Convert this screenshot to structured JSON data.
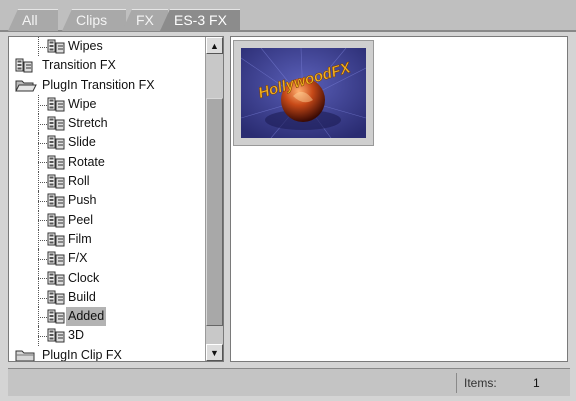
{
  "tabs": [
    {
      "label": "All",
      "active": false
    },
    {
      "label": "Clips",
      "active": false
    },
    {
      "label": "FX",
      "active": false
    },
    {
      "label": "ES-3 FX",
      "active": true
    }
  ],
  "tree": {
    "items": [
      {
        "label": "Wipes",
        "level": "child",
        "icon": "effect-icon"
      },
      {
        "label": "Transition FX",
        "level": "root",
        "icon": "effect-icon"
      },
      {
        "label": "PlugIn Transition FX",
        "level": "root",
        "icon": "open-folder-icon"
      },
      {
        "label": "Wipe",
        "level": "child",
        "icon": "effect-icon"
      },
      {
        "label": "Stretch",
        "level": "child",
        "icon": "effect-icon"
      },
      {
        "label": "Slide",
        "level": "child",
        "icon": "effect-icon"
      },
      {
        "label": "Rotate",
        "level": "child",
        "icon": "effect-icon"
      },
      {
        "label": "Roll",
        "level": "child",
        "icon": "effect-icon"
      },
      {
        "label": "Push",
        "level": "child",
        "icon": "effect-icon"
      },
      {
        "label": "Peel",
        "level": "child",
        "icon": "effect-icon"
      },
      {
        "label": "Film",
        "level": "child",
        "icon": "effect-icon"
      },
      {
        "label": "F/X",
        "level": "child",
        "icon": "effect-icon"
      },
      {
        "label": "Clock",
        "level": "child",
        "icon": "effect-icon"
      },
      {
        "label": "Build",
        "level": "child",
        "icon": "effect-icon"
      },
      {
        "label": "Added",
        "level": "child",
        "icon": "effect-icon",
        "selected": true
      },
      {
        "label": "3D",
        "level": "child",
        "icon": "effect-icon"
      },
      {
        "label": "PlugIn Clip FX",
        "level": "root",
        "icon": "closed-folder-icon"
      }
    ]
  },
  "content": {
    "thumbnail_logo": "HollywoodFX"
  },
  "status": {
    "items_label": "Items:",
    "items_count": "1"
  },
  "colors": {
    "background": "#d4d4d4",
    "active_tab": "#8c8c8c",
    "selection": "#b3b3b3",
    "logo_text": "#f0b020"
  }
}
